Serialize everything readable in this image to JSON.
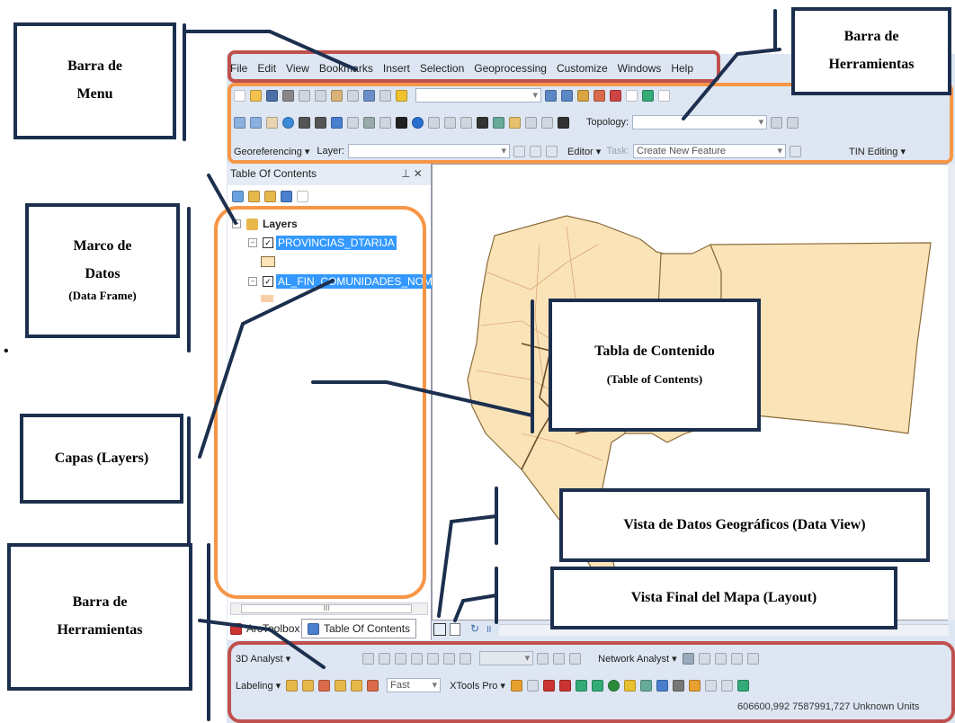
{
  "menu": [
    "File",
    "Edit",
    "View",
    "Bookmarks",
    "Insert",
    "Selection",
    "Geoprocessing",
    "Customize",
    "Windows",
    "Help"
  ],
  "toolbars": {
    "topology_label": "Topology:",
    "georeferencing": "Georeferencing ▾",
    "layer_label": "Layer:",
    "editor": "Editor ▾",
    "task_label": "Task:",
    "task_value": "Create New Feature",
    "tin_editing": "TIN Editing ▾"
  },
  "toc": {
    "title": "Table Of Contents",
    "pin": "⊥ ✕",
    "root": "Layers",
    "layers": [
      "PROVINCIAS_DTARIJA",
      "AL_FIN_COMUNIDADES_NOMBR"
    ],
    "tabs": [
      "ArcToolbox",
      "Table Of Contents"
    ],
    "scroll_thumb": "III"
  },
  "bottom_toolbars": {
    "analyst_3d": "3D Analyst ▾",
    "network_analyst": "Network Analyst ▾",
    "labeling": "Labeling ▾",
    "fast": "Fast",
    "xtools": "XTools Pro ▾",
    "coordinates": "606600,992  7587991,727 Unknown Units"
  },
  "annotations": {
    "menu": [
      "Barra de",
      "Menu"
    ],
    "tools_top": [
      "Barra de",
      "Herramientas"
    ],
    "frame": [
      "Marco  de",
      "Datos",
      "(Data Frame)"
    ],
    "layers": "Capas (Layers)",
    "toc": [
      "Tabla de Contenido",
      "(Table of Contents)"
    ],
    "dataview": "Vista de Datos Geográficos  (Data View)",
    "layout": "Vista Final del Mapa  (Layout)",
    "tools_bottom": [
      "Barra de",
      "Herramientas"
    ]
  },
  "colors": {
    "menu_frame": "#c0504d",
    "toolbar_frame": "#f79646",
    "toc_frame": "#f79646",
    "bottom_frame": "#c0504d",
    "annotation_border": "#1c2f4e",
    "map_fill": "#fbe3b8",
    "map_stroke": "#8a6a3a"
  }
}
